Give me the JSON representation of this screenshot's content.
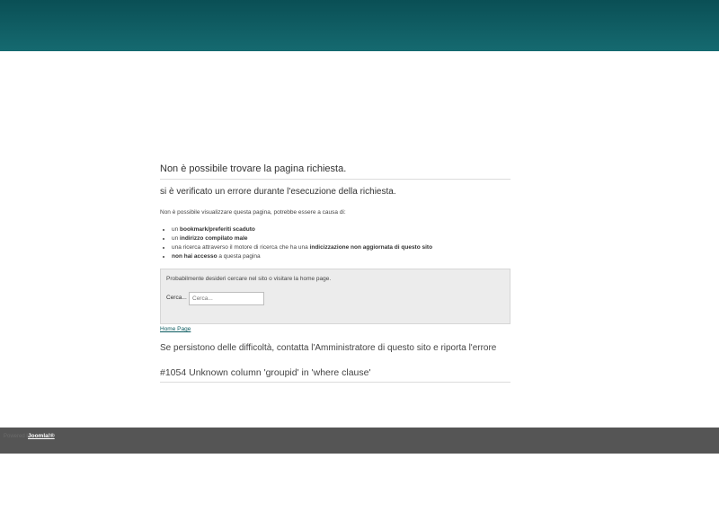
{
  "header": {
    "bg_color": "#0f5e64"
  },
  "error": {
    "title": "Non è possibile trovare la pagina richiesta.",
    "subtitle": "si è verificato un errore durante l'esecuzione della richiesta.",
    "intro": "Non è possibile visualizzare questa pagina, potrebbe essere a causa di:",
    "causes": [
      {
        "pre": "un ",
        "bold": "bookmark/preferiti scaduto",
        "post": ""
      },
      {
        "pre": "un ",
        "bold": "indirizzo compilato male",
        "post": ""
      },
      {
        "pre": "una ricerca attraverso il motore di ricerca che ha una ",
        "bold": "indicizzazione non aggiornata di questo sito",
        "post": ""
      },
      {
        "pre": "",
        "bold": "non hai accesso",
        "post": " a questa pagina"
      }
    ]
  },
  "search": {
    "hint": "Probabilmente desideri cercare nel sito o visitare la home page.",
    "label": "Cerca...",
    "placeholder": "Cerca...",
    "value": ""
  },
  "links": {
    "home": "Home Page"
  },
  "persist_text": "Se persistono delle difficoltà, contatta l'Amministratore di questo sito e riporta l'errore",
  "error_code": "#1054 Unknown column 'groupid' in 'where clause'",
  "footer": {
    "powered_by": "Powered by",
    "joomla_link": "Joomla!®",
    "bg_color": "#555555"
  }
}
